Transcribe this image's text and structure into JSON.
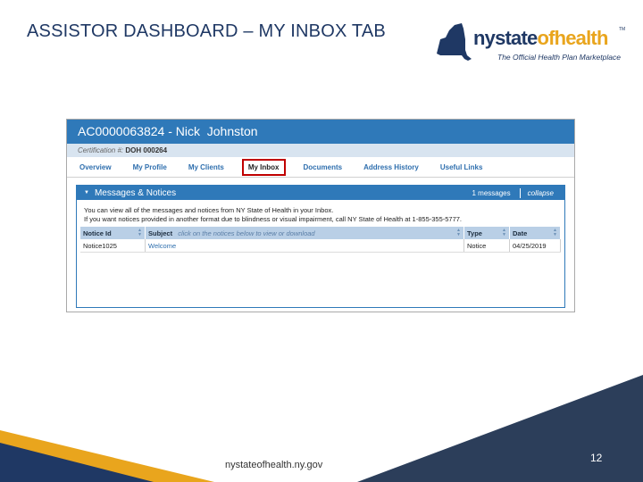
{
  "slide": {
    "title": "ASSISTOR DASHBOARD – MY INBOX TAB",
    "footer_url": "nystateofhealth.ny.gov",
    "page_number": "12"
  },
  "logo": {
    "word_ny": "nystate",
    "word_oh": "ofhealth",
    "tm": "TM",
    "tagline": "The Official Health Plan Marketplace"
  },
  "app": {
    "header_title": "AC0000063824 - Nick  Johnston",
    "cert_label": "Certification #:",
    "cert_value": "DOH 000264",
    "tabs": [
      {
        "label": "Overview"
      },
      {
        "label": "My Profile"
      },
      {
        "label": "My Clients"
      },
      {
        "label": "My Inbox",
        "active": true
      },
      {
        "label": "Documents"
      },
      {
        "label": "Address History"
      },
      {
        "label": "Useful Links"
      }
    ],
    "panel": {
      "title": "Messages & Notices",
      "count": "1 messages",
      "collapse": "collapse",
      "line1": "You can view all of the messages and notices from NY State of Health in your Inbox.",
      "line2": "If you want notices provided in another format due to blindness or visual impairment, call NY State of Health at 1-855-355-5777."
    },
    "table": {
      "headers": {
        "notice_id": "Notice Id",
        "subject": "Subject",
        "subject_hint": "click on the notices below to view or download",
        "type": "Type",
        "date": "Date"
      },
      "rows": [
        {
          "notice_id": "Notice1025",
          "subject": "Welcome",
          "type": "Notice",
          "date": "04/25/2019"
        }
      ]
    }
  },
  "colors": {
    "header_blue": "#2f79b9",
    "navy": "#1f3864",
    "gold": "#e9a51d",
    "active_tab_border": "#c00000",
    "footer_dark": "#2c3e5a"
  }
}
